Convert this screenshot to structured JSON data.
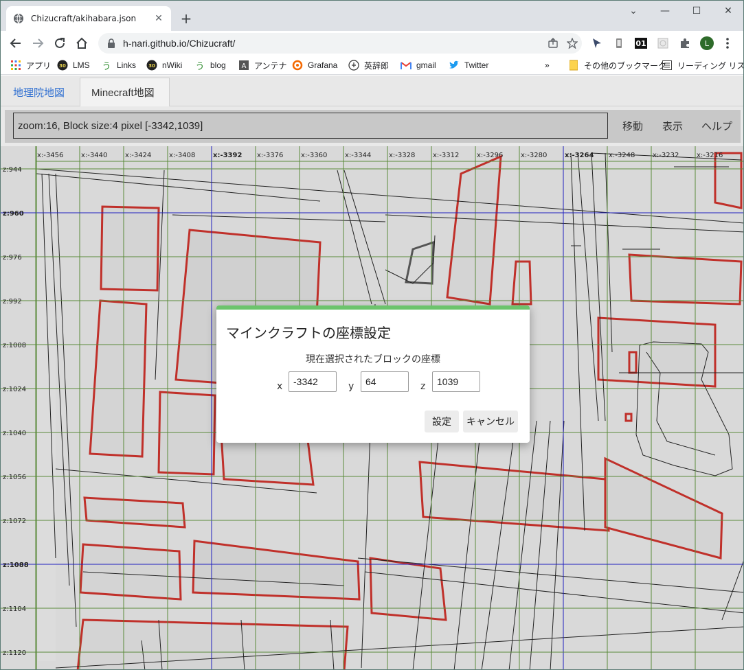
{
  "browser": {
    "tab_title": "Chizucraft/akihabara.json",
    "url": "h-nari.github.io/Chizucraft/",
    "profile_initial": "L"
  },
  "bookmarks": [
    {
      "label": "アプリ",
      "icon": "apps-grid-icon"
    },
    {
      "label": "LMS",
      "icon": "30-logo-icon"
    },
    {
      "label": "Links",
      "icon": "u-logo-icon"
    },
    {
      "label": "nWiki",
      "icon": "30-logo-icon"
    },
    {
      "label": "blog",
      "icon": "u-logo-icon"
    },
    {
      "label": "アンテナ",
      "icon": "antenna-icon"
    },
    {
      "label": "Grafana",
      "icon": "grafana-icon"
    },
    {
      "label": "英辞郎",
      "icon": "eijiro-icon"
    },
    {
      "label": "gmail",
      "icon": "gmail-icon"
    },
    {
      "label": "Twitter",
      "icon": "twitter-icon"
    },
    {
      "label": "その他のブックマーク",
      "icon": "folder-icon"
    },
    {
      "label": "リーディング リスト",
      "icon": "reading-list-icon"
    }
  ],
  "app": {
    "tabs": [
      "地理院地図",
      "Minecraft地図"
    ],
    "active_tab": "Minecraft地図",
    "info_text": "zoom:16, Block size:4 pixel [-3342,1039]",
    "buttons": {
      "move": "移動",
      "show": "表示",
      "help": "ヘルプ"
    }
  },
  "map": {
    "x_labels": [
      "x:-3456",
      "x:-3440",
      "x:-3424",
      "x:-3408",
      "x:-3392",
      "x:-3376",
      "x:-3360",
      "x:-3344",
      "x:-3328",
      "x:-3312",
      "x:-3296",
      "x:-3280",
      "x:-3264",
      "x:-3248",
      "x:-3232",
      "x:-3216"
    ],
    "z_labels": [
      "z:944",
      "z:960",
      "z:976",
      "z:992",
      "z:1008",
      "z:1024",
      "z:1040",
      "z:1056",
      "z:1072",
      "z:1088",
      "z:1104",
      "z:1120"
    ],
    "bold_x": [
      "x:-3392",
      "x:-3264"
    ],
    "bold_z": [
      "z:960",
      "z:1088"
    ],
    "colors": {
      "grid": "#5a8a3a",
      "major_grid": "#2020c0",
      "building": "#c0302a",
      "outline": "#222222",
      "block": "#777777"
    }
  },
  "dialog": {
    "title": "マインクラフトの座標設定",
    "subtitle": "現在選択されたブロックの座標",
    "x_label": "x",
    "x_value": "-3342",
    "y_label": "y",
    "y_value": "64",
    "z_label": "z",
    "z_value": "1039",
    "ok_label": "設定",
    "cancel_label": "キャンセル",
    "accent": "#6cc46c"
  }
}
